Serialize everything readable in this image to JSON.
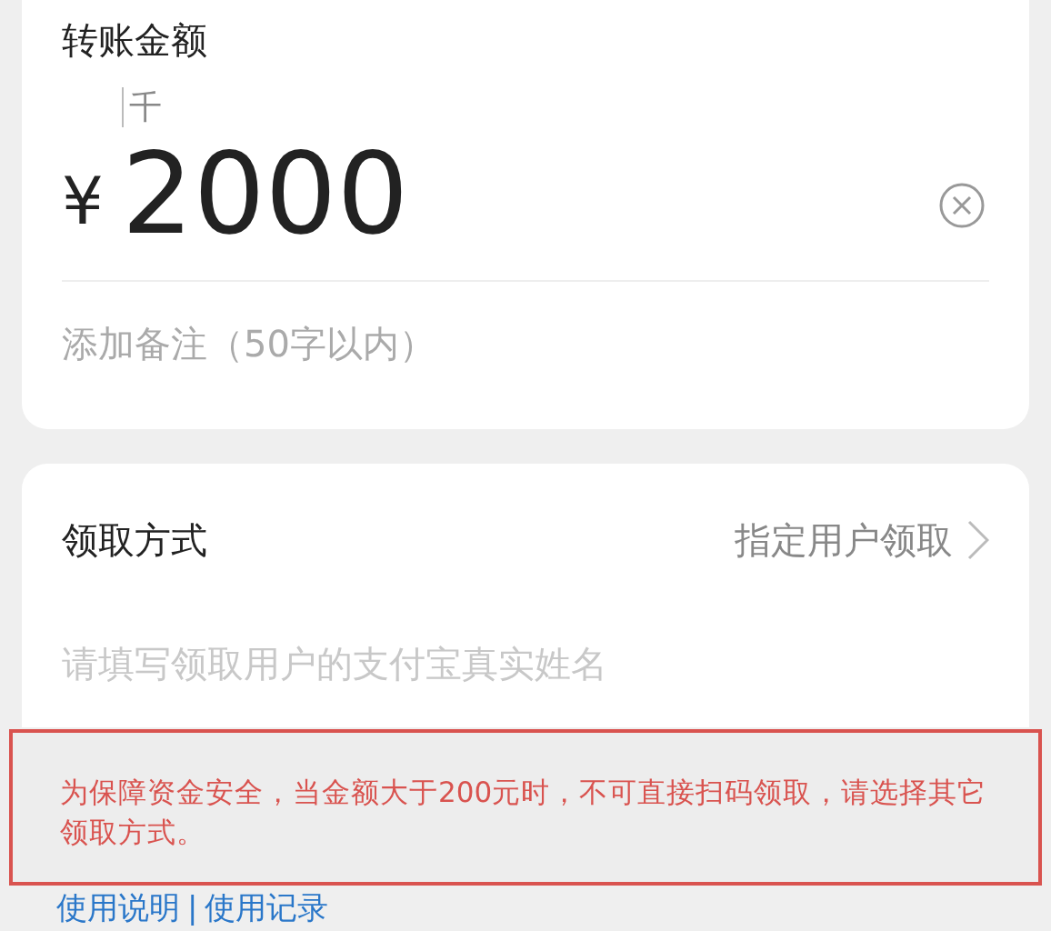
{
  "amount_card": {
    "title": "转账金额",
    "unit_hint": "千",
    "currency": "¥",
    "amount": "2000",
    "remark": {
      "placeholder": "添加备注（50字以内）"
    }
  },
  "method_card": {
    "label": "领取方式",
    "value": "指定用户领取",
    "name_field": {
      "placeholder": "请填写领取用户的支付宝真实姓名"
    }
  },
  "notice": "为保障资金安全，当金额大于200元时，不可直接扫码领取，请选择其它领取方式。",
  "links": [
    "使用说明",
    "使用记录"
  ],
  "link_separator": "|"
}
